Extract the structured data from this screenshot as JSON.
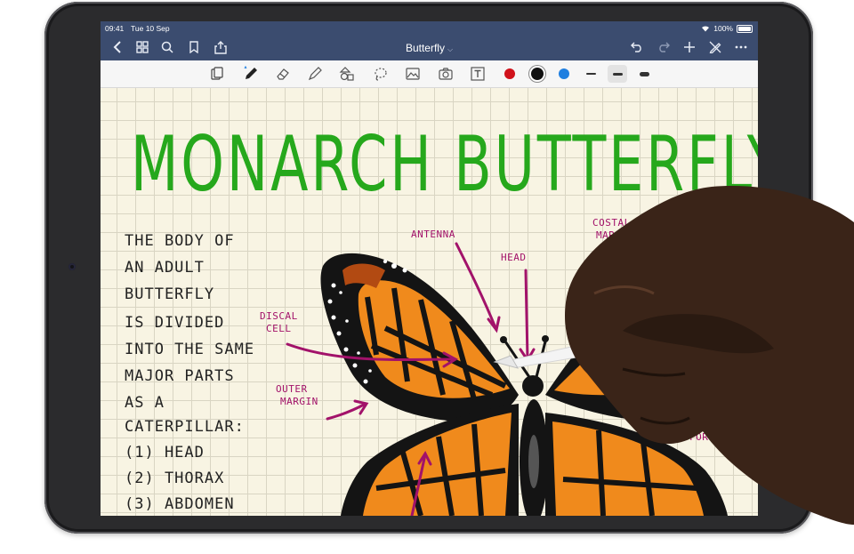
{
  "status_bar": {
    "time": "09:41",
    "date": "Tue 10 Sep",
    "battery": "100%"
  },
  "nav": {
    "title": "Butterfly",
    "left_icons": [
      "back-chevron-icon",
      "grid-icon",
      "search-icon",
      "bookmark-icon",
      "share-icon"
    ],
    "right_icons": [
      "undo-icon",
      "redo-icon",
      "plus-icon",
      "edit-off-icon",
      "more-icon"
    ]
  },
  "toolbar": {
    "tools": [
      "read-mode-icon",
      "pen-icon",
      "eraser-icon",
      "highlighter-icon",
      "shapes-icon",
      "lasso-icon",
      "image-icon",
      "camera-icon",
      "text-box-icon"
    ],
    "colors": [
      "#d0121b",
      "#111111",
      "#1f7fe0"
    ],
    "selected_color": "#111111",
    "stroke_widths": [
      "thin",
      "medium",
      "thick"
    ],
    "selected_stroke": "medium"
  },
  "note": {
    "heading": "MONARCH BUTTERFLY",
    "body_lines": [
      "THE BODY OF",
      "AN ADULT",
      "BUTTERFLY",
      "IS DIVIDED",
      "INTO THE SAME",
      "MAJOR PARTS",
      "AS A",
      "CATERPILLAR:",
      "(1) HEAD",
      "(2) THORAX",
      "(3) ABDOMEN"
    ],
    "labels": {
      "antenna": "ANTENNA",
      "head": "HEAD",
      "costal_margin_1": "COSTAL",
      "costal_margin_2": "MARGIN",
      "discal_cell_1": "DISCAL",
      "discal_cell_2": "CELL",
      "outer_margin_1": "OUTER",
      "outer_margin_2": "MARGIN",
      "forewing": "FOREWI"
    },
    "colors": {
      "heading": "#26a81c",
      "labels": "#a2126a",
      "wing_orange": "#f08a1c",
      "wing_black": "#141414"
    }
  }
}
